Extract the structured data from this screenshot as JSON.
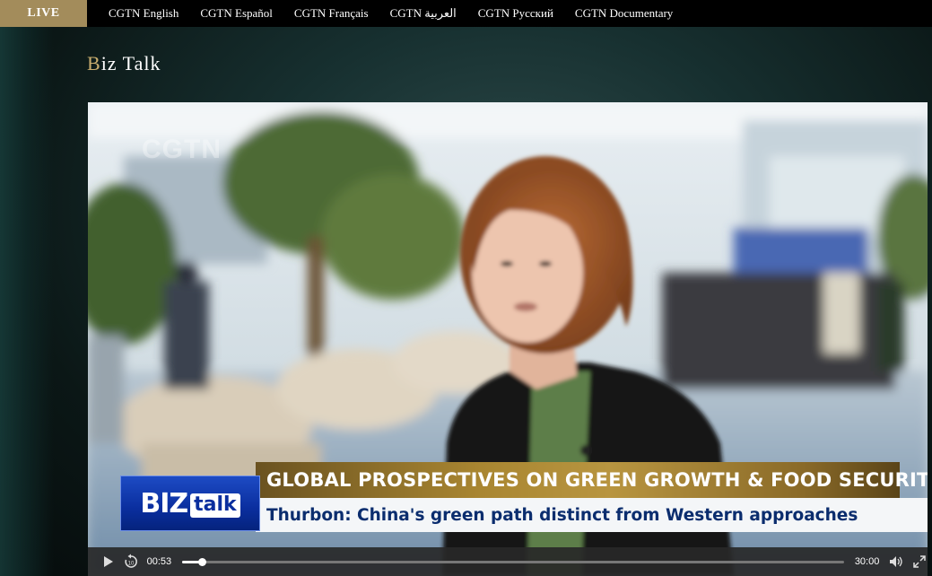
{
  "nav": {
    "live_label": "LIVE",
    "links": [
      "CGTN English",
      "CGTN Español",
      "CGTN Français",
      "CGTN العربية",
      "CGTN Русский",
      "CGTN Documentary"
    ]
  },
  "page": {
    "title_first": "B",
    "title_rest": "iz Talk"
  },
  "video": {
    "watermark": "CGTN",
    "logo_biz": "BIZ",
    "logo_talk": "talk",
    "headline": "GLOBAL PROSPECTIVES ON GREEN GROWTH & FOOD SECURITY",
    "subheadline": "Thurbon: China's green path distinct from Western approaches"
  },
  "player": {
    "current_time": "00:53",
    "total_time": "30:00",
    "progress_fraction": 0.03,
    "icons": [
      "play-icon",
      "rewind-10-icon",
      "volume-icon",
      "fullscreen-icon"
    ]
  },
  "colors": {
    "live_bg": "#a38c5b",
    "title_accent": "#c8ad6e",
    "headline_gold": "#a98631",
    "subheadline_text": "#0b2d6e",
    "logo_blue": "#0a2e9e"
  }
}
